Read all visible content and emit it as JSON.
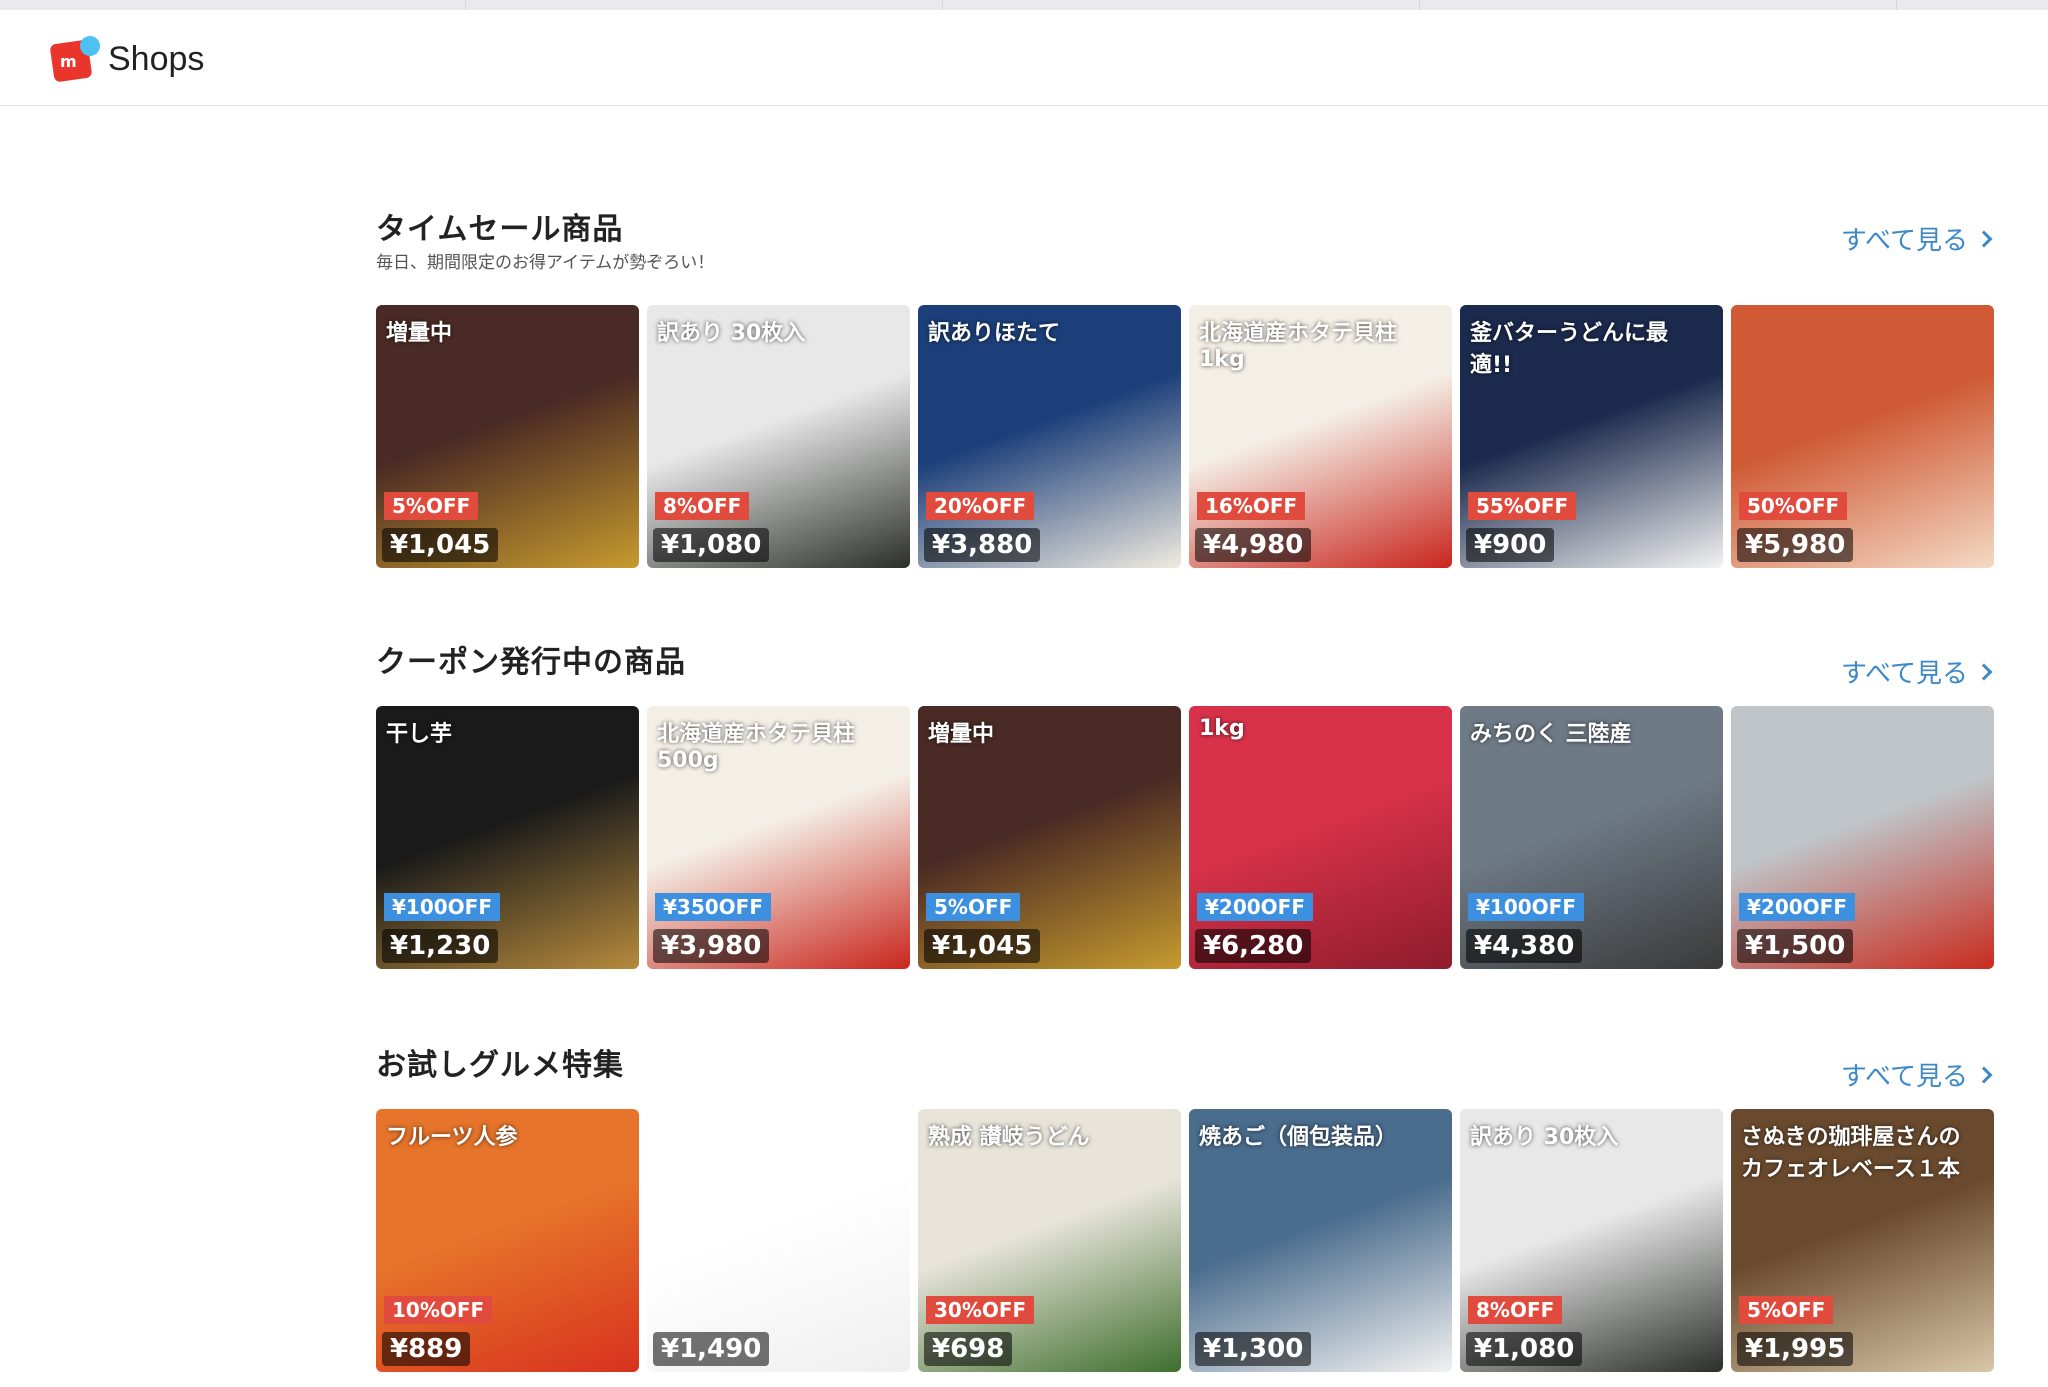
{
  "brand": {
    "name": "Shops"
  },
  "sections": [
    {
      "title": "タイムセール商品",
      "subtitle": "毎日、期間限定のお得アイテムが勢ぞろい！",
      "see_all": "すべて見る",
      "items": [
        {
          "caption": "増量中",
          "badge": "5%OFF",
          "badge_type": "sale",
          "price": "¥1,045",
          "colors": [
            "#4a2a24",
            "#c79a2e"
          ]
        },
        {
          "caption": "訳あり 30枚入",
          "badge": "8%OFF",
          "badge_type": "sale",
          "price": "¥1,080",
          "colors": [
            "#e8e8e8",
            "#2b2f2b"
          ]
        },
        {
          "caption": "訳ありほたて",
          "badge": "20%OFF",
          "badge_type": "sale",
          "price": "¥3,880",
          "colors": [
            "#1c3f7a",
            "#f0ebe0"
          ]
        },
        {
          "caption": "北海道産ホタテ貝柱1kg",
          "badge": "16%OFF",
          "badge_type": "sale",
          "price": "¥4,980",
          "colors": [
            "#f4efe6",
            "#c9261d"
          ]
        },
        {
          "caption": "釜バターうどんに最適!!",
          "badge": "55%OFF",
          "badge_type": "sale",
          "price": "¥900",
          "colors": [
            "#1b2a4d",
            "#f2f2f2"
          ]
        },
        {
          "caption": "",
          "badge": "50%OFF",
          "badge_type": "sale",
          "price": "¥5,980",
          "colors": [
            "#cf5a35",
            "#f4d9c4"
          ]
        }
      ]
    },
    {
      "title": "クーポン発行中の商品",
      "subtitle": "",
      "see_all": "すべて見る",
      "items": [
        {
          "caption": "干し芋",
          "badge": "¥100OFF",
          "badge_type": "coupon",
          "price": "¥1,230",
          "colors": [
            "#1a1a1a",
            "#b68a3c"
          ]
        },
        {
          "caption": "北海道産ホタテ貝柱500g",
          "badge": "¥350OFF",
          "badge_type": "coupon",
          "price": "¥3,980",
          "colors": [
            "#f4efe6",
            "#c9261d"
          ]
        },
        {
          "caption": "増量中",
          "badge": "5%OFF",
          "badge_type": "coupon",
          "price": "¥1,045",
          "colors": [
            "#4a2a24",
            "#c79a2e"
          ]
        },
        {
          "caption": "1kg",
          "badge": "¥200OFF",
          "badge_type": "coupon",
          "price": "¥6,280",
          "colors": [
            "#d8324a",
            "#8e1c2b"
          ]
        },
        {
          "caption": "みちのく 三陸産",
          "badge": "¥100OFF",
          "badge_type": "coupon",
          "price": "¥4,380",
          "colors": [
            "#6e7a86",
            "#3a3a3a"
          ]
        },
        {
          "caption": "",
          "badge": "¥200OFF",
          "badge_type": "coupon",
          "price": "¥1,500",
          "colors": [
            "#bfc5c9",
            "#c92b1e"
          ]
        }
      ]
    },
    {
      "title": "お試しグルメ特集",
      "subtitle": "",
      "see_all": "すべて見る",
      "items": [
        {
          "caption": "フルーツ人参",
          "badge": "10%OFF",
          "badge_type": "sale",
          "price": "¥889",
          "colors": [
            "#e6742a",
            "#d8321e"
          ]
        },
        {
          "caption": "",
          "badge": "",
          "badge_type": "",
          "price": "¥1,490",
          "colors": [
            "#ffffff",
            "#efefef"
          ]
        },
        {
          "caption": "熟成 讃岐うどん",
          "badge": "30%OFF",
          "badge_type": "sale",
          "price": "¥698",
          "colors": [
            "#e8e4da",
            "#3f6f2e"
          ]
        },
        {
          "caption": "焼あご（個包装品）",
          "badge": "",
          "badge_type": "",
          "price": "¥1,300",
          "colors": [
            "#4a6c8d",
            "#f2f2f2"
          ]
        },
        {
          "caption": "訳あり 30枚入",
          "badge": "8%OFF",
          "badge_type": "sale",
          "price": "¥1,080",
          "colors": [
            "#e8e8e8",
            "#2b2f2b"
          ]
        },
        {
          "caption": "さぬきの珈琲屋さんのカフェオレベース１本",
          "badge": "5%OFF",
          "badge_type": "sale",
          "price": "¥1,995",
          "colors": [
            "#6a4a2e",
            "#d9c6a8"
          ]
        }
      ]
    }
  ]
}
